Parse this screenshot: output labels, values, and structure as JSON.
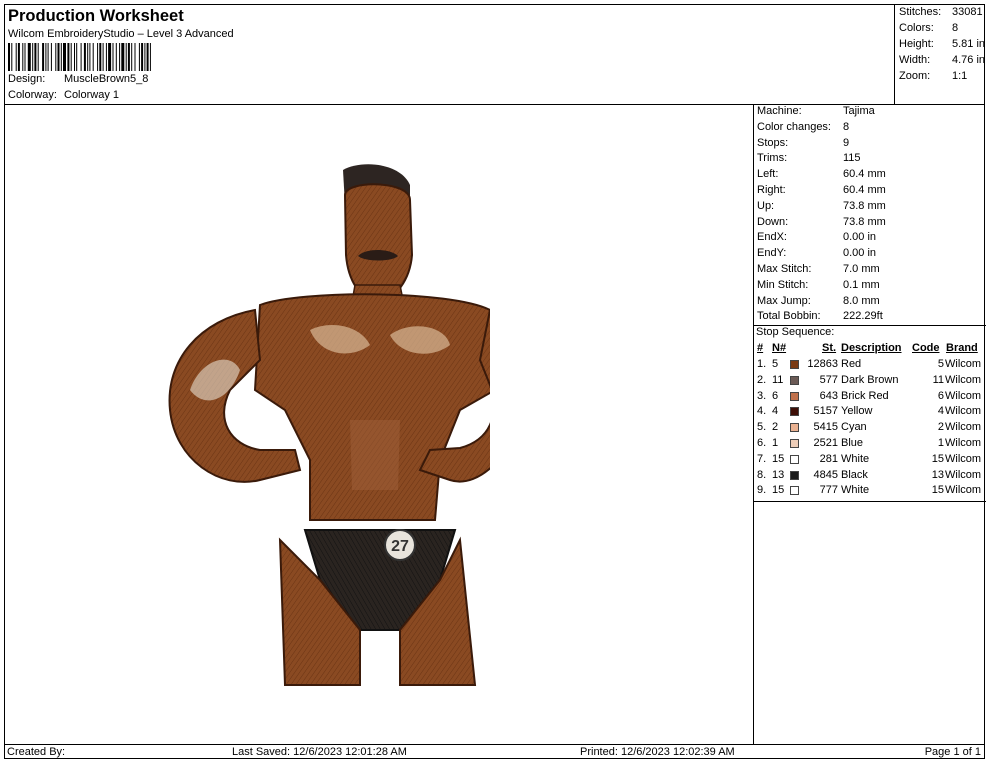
{
  "header": {
    "title": "Production Worksheet",
    "subtitle": "Wilcom EmbroideryStudio – Level 3 Advanced",
    "design_label": "Design:",
    "design_value": "MuscleBrown5_8",
    "colorway_label": "Colorway:",
    "colorway_value": "Colorway 1"
  },
  "stats": [
    {
      "label": "Stitches:",
      "value": "33081"
    },
    {
      "label": "Colors:",
      "value": "8"
    },
    {
      "label": "Height:",
      "value": "5.81 in"
    },
    {
      "label": "Width:",
      "value": "4.76 in"
    },
    {
      "label": "Zoom:",
      "value": "1:1"
    }
  ],
  "machine_info": [
    {
      "label": "Machine:",
      "value": "Tajima"
    },
    {
      "label": "Color changes:",
      "value": "8"
    },
    {
      "label": "Stops:",
      "value": "9"
    },
    {
      "label": "Trims:",
      "value": "115"
    },
    {
      "label": "Left:",
      "value": "60.4 mm"
    },
    {
      "label": "Right:",
      "value": "60.4 mm"
    },
    {
      "label": "Up:",
      "value": "73.8 mm"
    },
    {
      "label": "Down:",
      "value": "73.8 mm"
    },
    {
      "label": "EndX:",
      "value": "0.00 in"
    },
    {
      "label": "EndY:",
      "value": "0.00 in"
    },
    {
      "label": "Max Stitch:",
      "value": "7.0 mm"
    },
    {
      "label": "Min Stitch:",
      "value": "0.1 mm"
    },
    {
      "label": "Max Jump:",
      "value": "8.0 mm"
    },
    {
      "label": "Total Bobbin:",
      "value": "222.29ft"
    }
  ],
  "stop_sequence": {
    "title": "Stop Sequence:",
    "headers": {
      "num": "#",
      "n": "N#",
      "st": "St.",
      "description": "Description",
      "code": "Code",
      "brand": "Brand"
    },
    "rows": [
      {
        "num": "1.",
        "n": "5",
        "color": "#7a3a14",
        "st": "12863",
        "description": "Red",
        "code": "5",
        "brand": "Wilcom"
      },
      {
        "num": "2.",
        "n": "11",
        "color": "#6b5a55",
        "st": "577",
        "description": "Dark Brown",
        "code": "11",
        "brand": "Wilcom"
      },
      {
        "num": "3.",
        "n": "6",
        "color": "#c0714c",
        "st": "643",
        "description": "Brick Red",
        "code": "6",
        "brand": "Wilcom"
      },
      {
        "num": "4.",
        "n": "4",
        "color": "#3d0e06",
        "st": "5157",
        "description": "Yellow",
        "code": "4",
        "brand": "Wilcom"
      },
      {
        "num": "5.",
        "n": "2",
        "color": "#e9b191",
        "st": "5415",
        "description": "Cyan",
        "code": "2",
        "brand": "Wilcom"
      },
      {
        "num": "6.",
        "n": "1",
        "color": "#edcdb8",
        "st": "2521",
        "description": "Blue",
        "code": "1",
        "brand": "Wilcom"
      },
      {
        "num": "7.",
        "n": "15",
        "color": "#ffffff",
        "st": "281",
        "description": "White",
        "code": "15",
        "brand": "Wilcom"
      },
      {
        "num": "8.",
        "n": "13",
        "color": "#1a1a1a",
        "st": "4845",
        "description": "Black",
        "code": "13",
        "brand": "Wilcom"
      },
      {
        "num": "9.",
        "n": "15",
        "color": "#ffffff",
        "st": "777",
        "description": "White",
        "code": "15",
        "brand": "Wilcom"
      }
    ]
  },
  "design_preview": {
    "badge_number": "27"
  },
  "footer": {
    "created_by": "Created By:",
    "last_saved": "Last Saved: 12/6/2023 12:01:28 AM",
    "printed": "Printed: 12/6/2023 12:02:39 AM",
    "page": "Page 1 of 1"
  }
}
